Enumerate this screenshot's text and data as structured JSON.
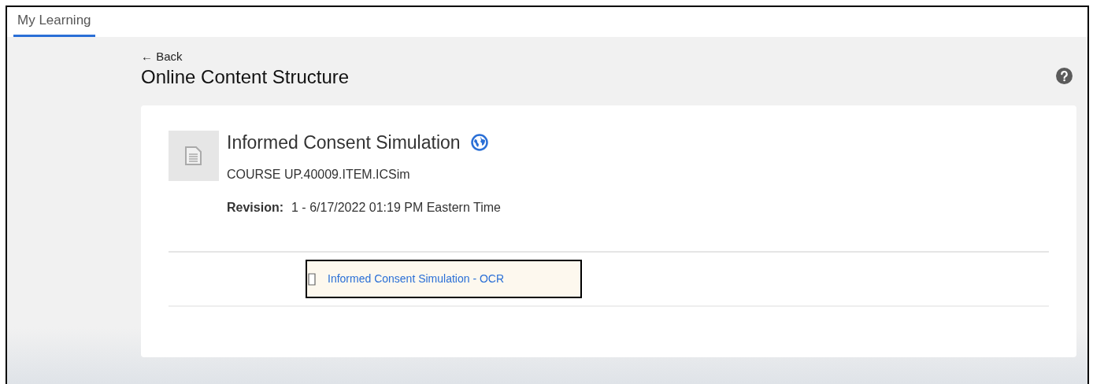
{
  "tabs": [
    {
      "label": "My Learning",
      "selected": true
    }
  ],
  "back_link": "← Back",
  "page_title": "Online Content Structure",
  "course": {
    "title": "Informed Consent Simulation",
    "code": "COURSE UP.40009.ITEM.ICSim",
    "revision_label": "Revision:",
    "revision_value": "1 - 6/17/2022 01:19 PM Eastern Time"
  },
  "items": [
    {
      "label": "Informed Consent Simulation - OCR",
      "highlighted": true
    }
  ]
}
